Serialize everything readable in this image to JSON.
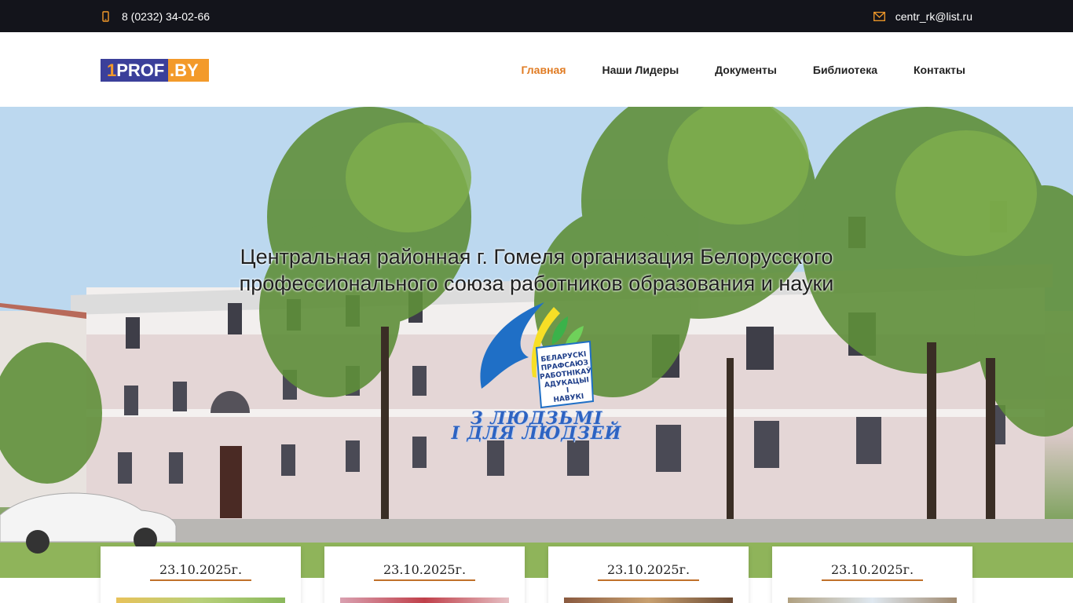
{
  "topbar": {
    "phone": "8 (0232) 34-02-66",
    "email": "centr_rk@list.ru",
    "phone_icon": "mobile-phone-icon",
    "email_icon": "envelope-icon",
    "accent": "#f39a2a"
  },
  "header": {
    "logo": {
      "part1": "1",
      "part2": "PROF",
      "part3": ".BY"
    },
    "nav": [
      {
        "label": "Главная",
        "active": true
      },
      {
        "label": "Наши Лидеры",
        "active": false
      },
      {
        "label": "Документы",
        "active": false
      },
      {
        "label": "Библиотека",
        "active": false
      },
      {
        "label": "Контакты",
        "active": false
      }
    ],
    "active_color": "#e07b22"
  },
  "hero": {
    "title_line1": "Центральная районная г. Гомеля организация Белорусского",
    "title_line2": "профессионального союза работников образования и науки",
    "emblem_text": [
      "БЕЛАРУСКІ",
      "ПРАФСАЮЗ",
      "РАБОТНІКАЎ",
      "АДУКАЦЫІ",
      "І",
      "НАВУКІ"
    ],
    "slogan_line1": "З ЛЮДЗЬМІ",
    "slogan_line2": "І ДЛЯ ЛЮДЗЕЙ"
  },
  "news": [
    {
      "date": "23.10.2025г."
    },
    {
      "date": "23.10.2025г."
    },
    {
      "date": "23.10.2025г."
    },
    {
      "date": "23.10.2025г."
    }
  ]
}
